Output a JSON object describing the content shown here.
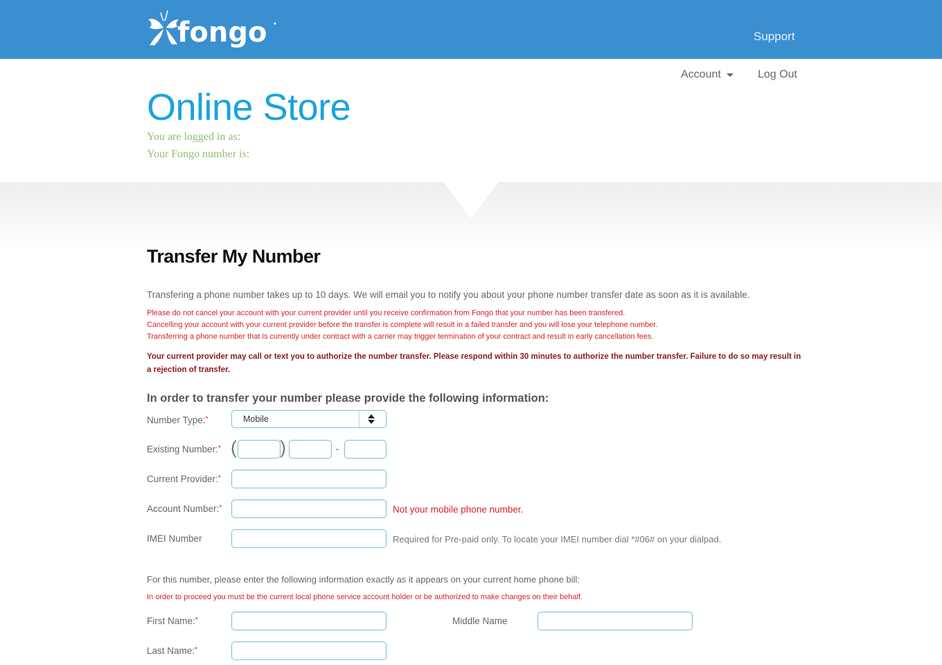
{
  "header": {
    "brand": "fongo",
    "support_label": "Support",
    "brand_color": "#3a8fd0"
  },
  "nav": {
    "account_label": "Account",
    "logout_label": "Log Out"
  },
  "store": {
    "title": "Online Store",
    "logged_in_label": "You are logged in as:",
    "number_label": "Your Fongo number is:"
  },
  "page": {
    "heading": "Transfer My Number",
    "intro": "Transfering a phone number takes up to 10 days. We will email you to notify you about your phone number transfer date as soon as it is available.",
    "warnings": [
      "Please do not cancel your account with your current provider until you receive confirmation from Fongo that your number has been transfered.",
      "Cancelling your account with your current provider before the transfer is complete will result in a failed transfer and you will lose your telephone number.",
      "Transferring a phone number that is currently under contract with a carrier may trigger termination of your contract and result in early cancellation fees."
    ],
    "bold_warning": "Your current provider may call or text you to authorize the number transfer. Please respond within 30 minutes to authorize the number transfer. Failure to do so may result in a rejection of transfer.",
    "section_heading": "In order to transfer your number please provide the following information:"
  },
  "form": {
    "required_mark": "*",
    "number_type": {
      "label": "Number Type:",
      "value": "Mobile"
    },
    "existing_number": {
      "label": "Existing Number:",
      "open_paren": "(",
      "close_paren": ")",
      "dash": "-",
      "area": "",
      "prefix": "",
      "line": ""
    },
    "current_provider": {
      "label": "Current Provider:",
      "value": ""
    },
    "account_number": {
      "label": "Account Number:",
      "value": "",
      "hint": "Not your mobile phone number."
    },
    "imei": {
      "label": "IMEI Number",
      "value": "",
      "hint": "Required for Pre-paid only. To locate your IMEI number dial *#06# on your dialpad."
    },
    "bill_intro": "For this number, please enter the following information exactly as it appears on your current home phone bill:",
    "bill_warning": "In order to proceed you must be the current local phone service account holder or be authorized to make changes on their behalf.",
    "first_name": {
      "label": "First Name:",
      "value": ""
    },
    "middle_name": {
      "label": "Middle Name",
      "value": ""
    },
    "last_name": {
      "label": "Last Name:",
      "value": ""
    }
  }
}
